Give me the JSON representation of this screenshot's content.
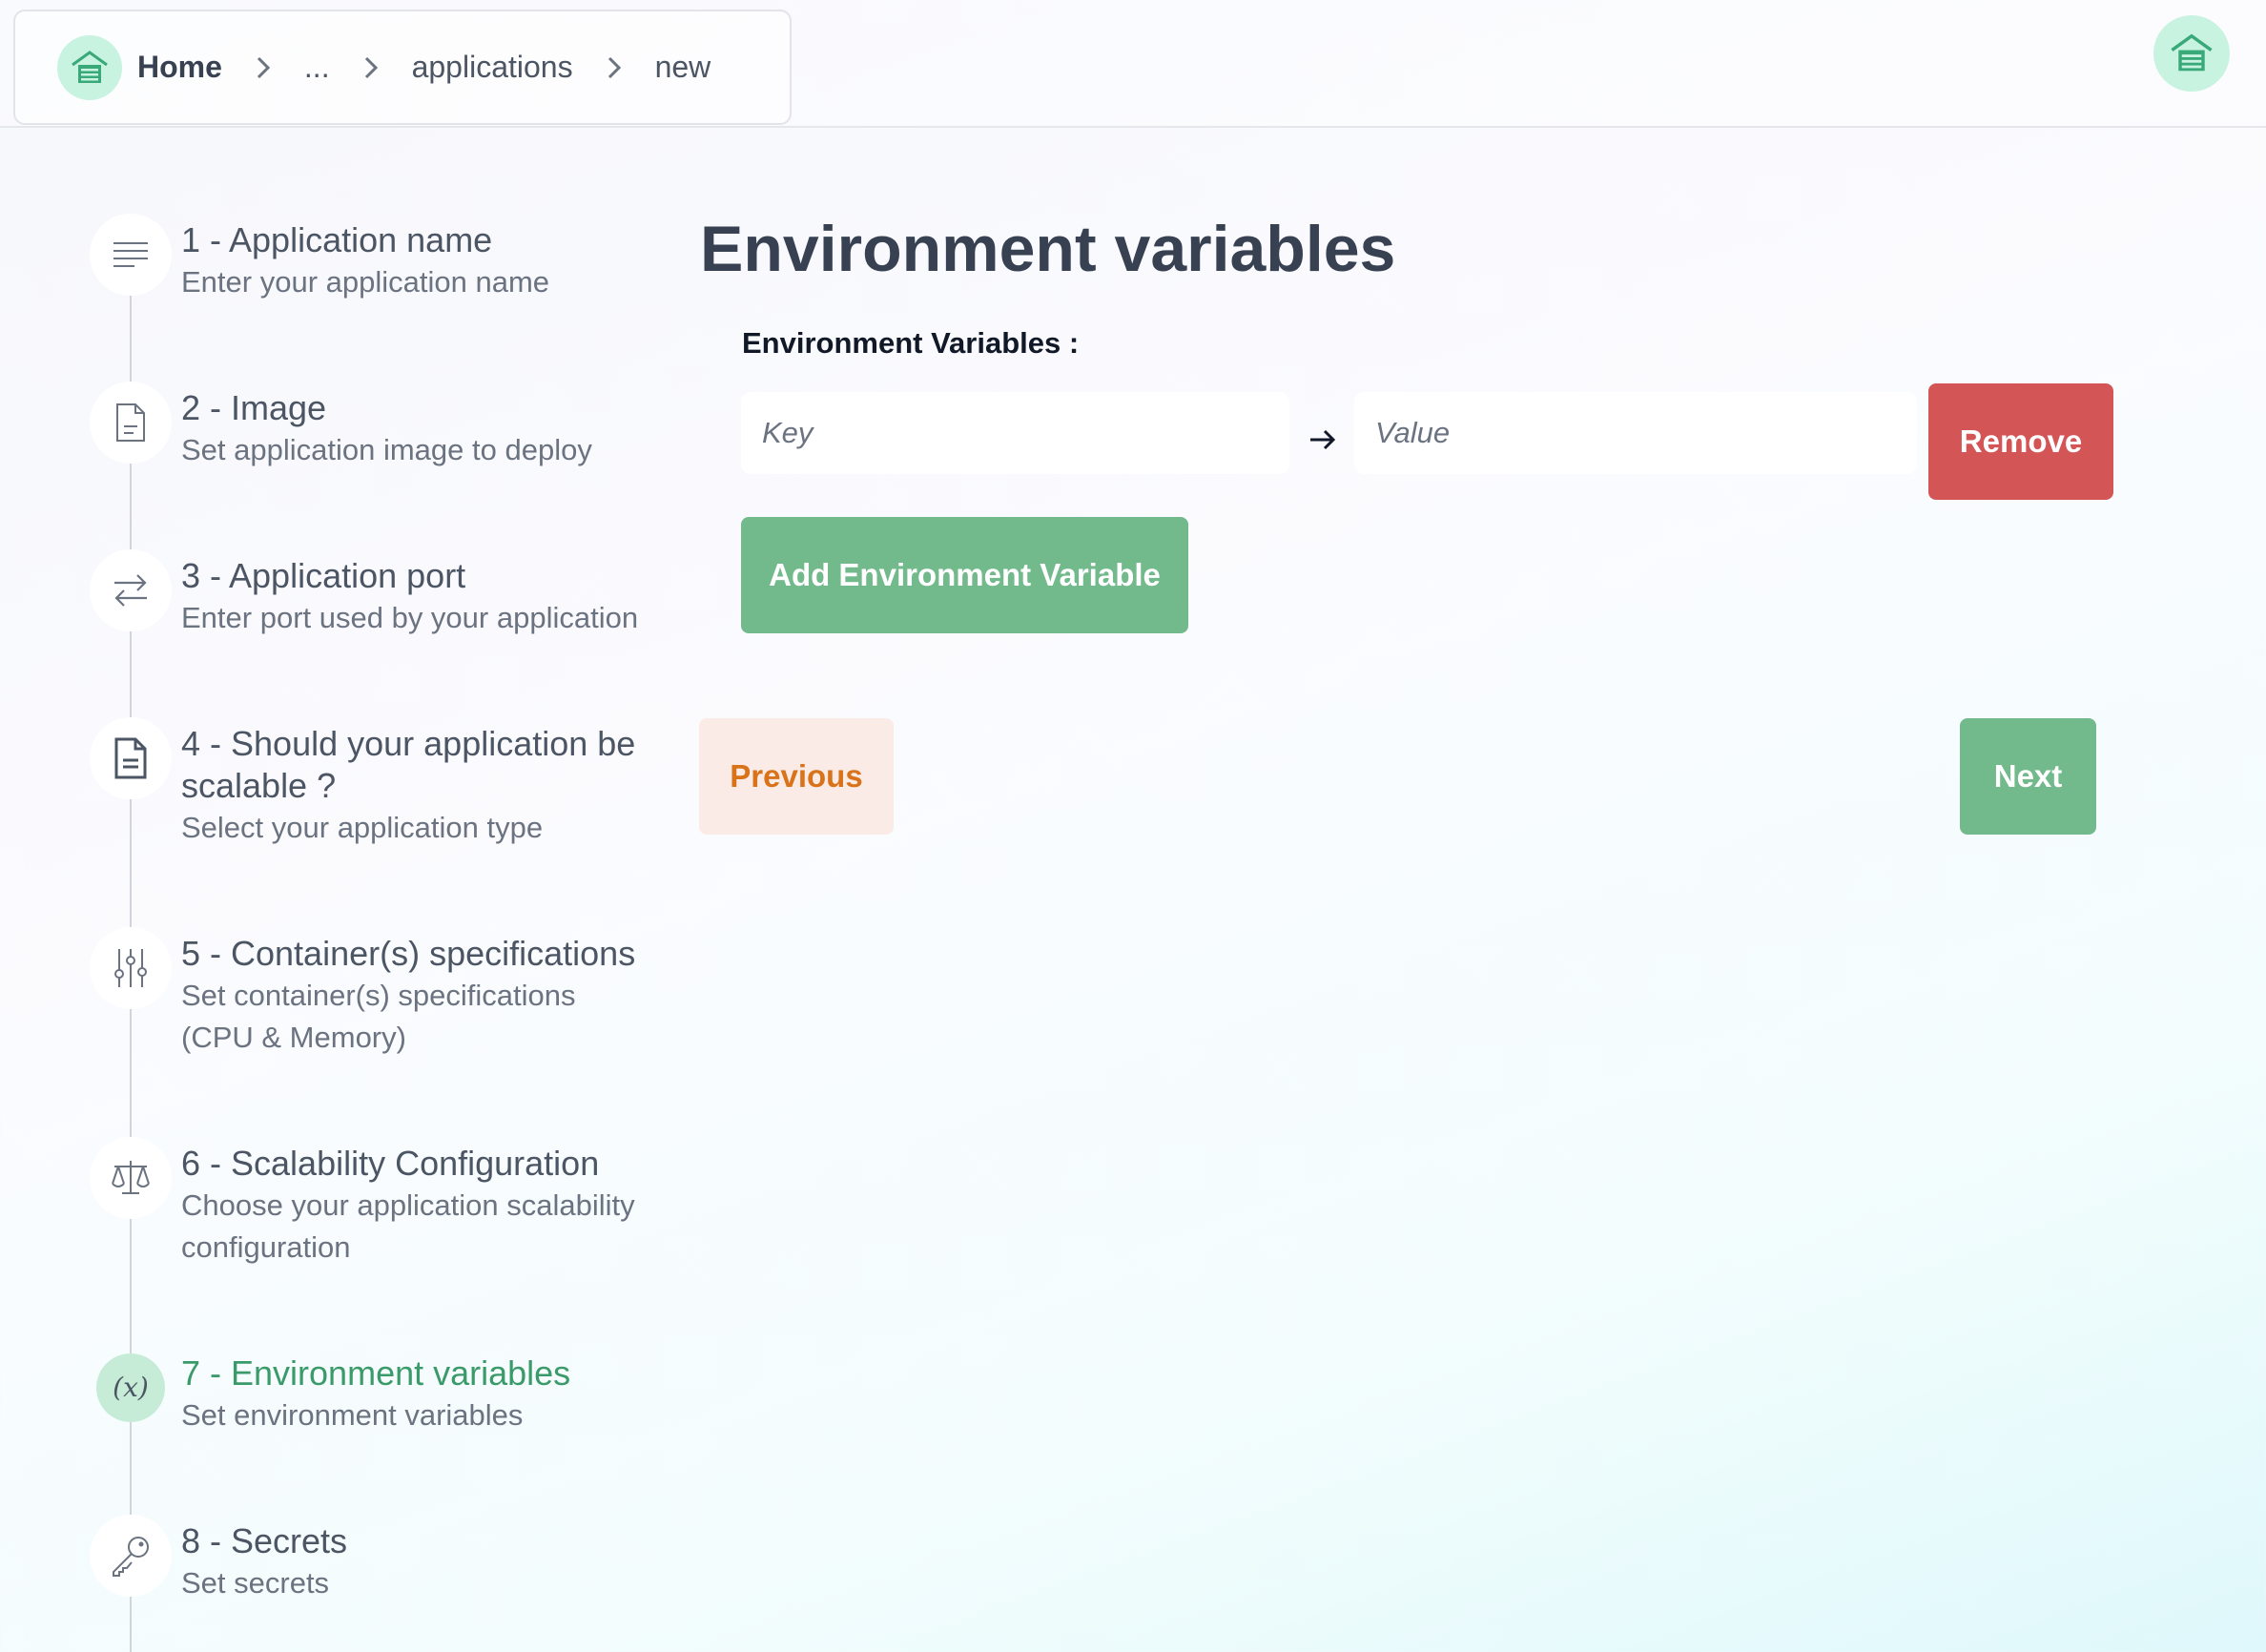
{
  "header": {
    "breadcrumb": [
      "Home",
      "...",
      "applications",
      "new"
    ],
    "logo_icon": "house-logo-icon",
    "accent_color": "#c8f3e0"
  },
  "steps": [
    {
      "title": "1 - Application name",
      "desc": [
        "Enter your application name"
      ],
      "icon": "text-lines-icon"
    },
    {
      "title": "2 - Image",
      "desc": [
        "Set application image to deploy"
      ],
      "icon": "file-icon"
    },
    {
      "title": "3 - Application port",
      "desc": [
        "Enter port used by your application"
      ],
      "icon": "arrows-exchange-icon"
    },
    {
      "title": [
        "4 - Should your application be",
        "scalable ?"
      ],
      "desc": [
        "Select your application type"
      ],
      "icon": "document-icon"
    },
    {
      "title": "5 - Container(s) specifications",
      "desc": [
        "Set container(s) specifications",
        "(CPU & Memory)"
      ],
      "icon": "sliders-icon"
    },
    {
      "title": "6 - Scalability Configuration",
      "desc": [
        "Choose your application scalability",
        "configuration"
      ],
      "icon": "scale-icon"
    },
    {
      "title": "7 - Environment variables",
      "desc": [
        "Set environment variables"
      ],
      "icon": "variable-icon",
      "active": true
    },
    {
      "title": "8 - Secrets",
      "desc": [
        "Set secrets"
      ],
      "icon": "key-icon"
    }
  ],
  "main": {
    "title": "Environment variables",
    "env_label": "Environment Variables :",
    "key_placeholder": "Key",
    "value_placeholder": "Value",
    "remove_label": "Remove",
    "add_label": "Add Environment Variable",
    "previous_label": "Previous",
    "next_label": "Next"
  },
  "colors": {
    "active_step": "#3a9a6a",
    "green_button": "#72b98c",
    "red_button": "#d45555",
    "previous_bg": "#fbebe6",
    "previous_text": "#d9731a"
  }
}
